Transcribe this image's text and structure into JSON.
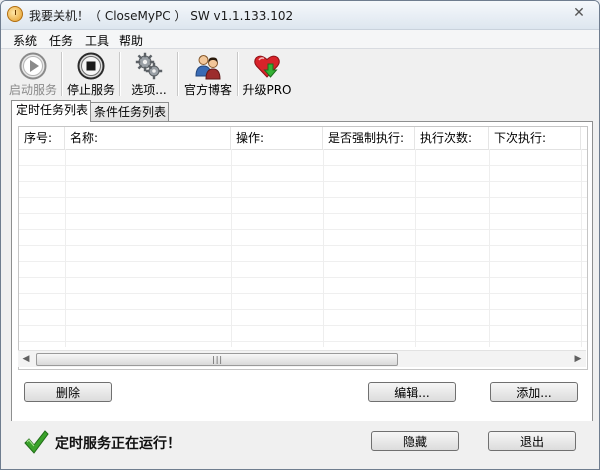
{
  "window": {
    "title": "我要关机！（ CloseMyPC ） SW v1.1.133.102"
  },
  "menu": {
    "items": [
      "系统",
      "任务",
      "工具",
      "帮助"
    ]
  },
  "toolbar": {
    "start_label": "启动服务",
    "stop_label": "停止服务",
    "options_label": "选项...",
    "blog_label": "官方博客",
    "upgrade_label": "升级PRO"
  },
  "tabs": [
    {
      "label": "定时任务列表",
      "active": true
    },
    {
      "label": "条件任务列表",
      "active": false
    }
  ],
  "table": {
    "columns": [
      "序号:",
      "名称:",
      "操作:",
      "是否强制执行:",
      "执行次数:",
      "下次执行:"
    ],
    "rows": []
  },
  "buttons": {
    "delete": "删除",
    "edit": "编辑...",
    "add": "添加...",
    "hide": "隐藏",
    "exit": "退出"
  },
  "status": {
    "text": "定时服务正在运行！"
  },
  "colors": {
    "check_green": "#3aa22a",
    "upgrade_red": "#d8232a",
    "upgrade_green": "#2fa32f"
  }
}
